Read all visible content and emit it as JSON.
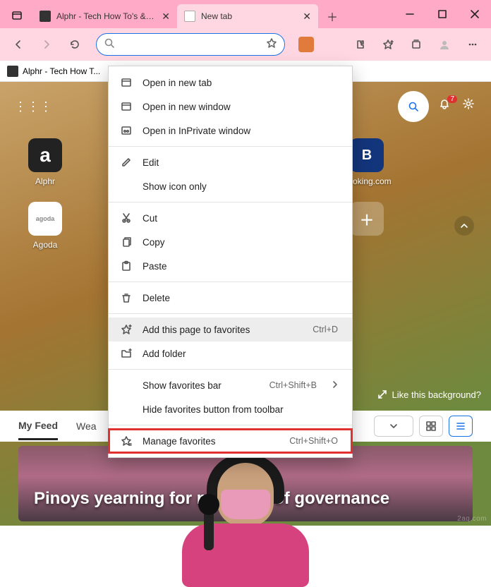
{
  "tabs": [
    {
      "title": "Alphr - Tech How To's & Gui…"
    },
    {
      "title": "New tab"
    }
  ],
  "bookmarks_bar": {
    "items": [
      {
        "label": "Alphr - Tech How T..."
      }
    ]
  },
  "ntp": {
    "notifications": "7",
    "tiles": [
      {
        "label": "Alphr"
      },
      {
        "label": "Booking.com",
        "letter": "B"
      },
      {
        "label": "Agoda"
      }
    ],
    "like_bg": "Like this background?"
  },
  "feed": {
    "tabs": [
      "My Feed",
      "Wea"
    ],
    "headline": "Pinoys yearning for new kind of governance"
  },
  "context_menu": {
    "items": [
      {
        "icon": "tab",
        "label": "Open in new tab"
      },
      {
        "icon": "window",
        "label": "Open in new window"
      },
      {
        "icon": "inprivate",
        "label": "Open in InPrivate window"
      },
      {
        "sep": true
      },
      {
        "icon": "edit",
        "label": "Edit"
      },
      {
        "icon": "",
        "label": "Show icon only"
      },
      {
        "sep": true
      },
      {
        "icon": "cut",
        "label": "Cut"
      },
      {
        "icon": "copy",
        "label": "Copy"
      },
      {
        "icon": "paste",
        "label": "Paste"
      },
      {
        "sep": true
      },
      {
        "icon": "delete",
        "label": "Delete"
      },
      {
        "sep": true
      },
      {
        "icon": "favadd",
        "label": "Add this page to favorites",
        "shortcut": "Ctrl+D",
        "hovered": true
      },
      {
        "icon": "folder",
        "label": "Add folder"
      },
      {
        "sep": true
      },
      {
        "icon": "",
        "label": "Show favorites bar",
        "shortcut": "Ctrl+Shift+B",
        "submenu": true
      },
      {
        "icon": "",
        "label": "Hide favorites button from toolbar"
      },
      {
        "sep": true
      },
      {
        "icon": "favmgr",
        "label": "Manage favorites",
        "shortcut": "Ctrl+Shift+O",
        "highlight": true
      }
    ]
  },
  "watermark": "2aq.com"
}
